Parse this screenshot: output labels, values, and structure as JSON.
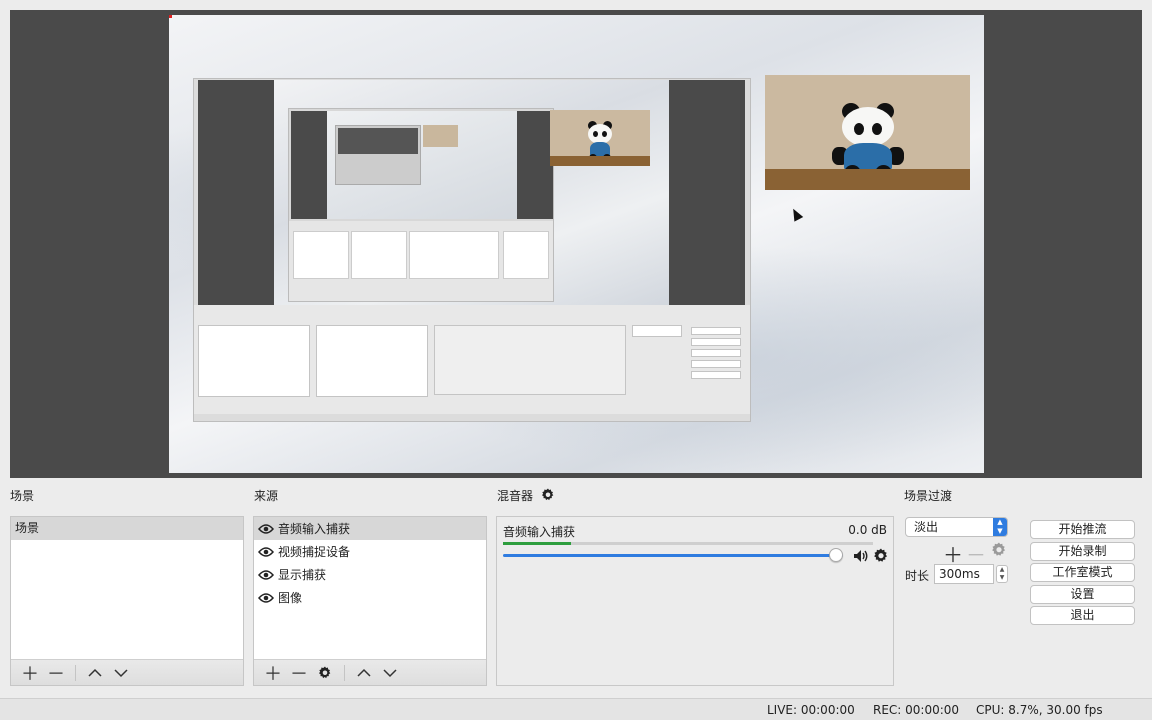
{
  "panels": {
    "scenes_title": "场景",
    "sources_title": "来源",
    "mixer_title": "混音器",
    "transitions_title": "场景过渡"
  },
  "scenes": {
    "items": [
      {
        "label": "场景"
      }
    ]
  },
  "sources": {
    "items": [
      {
        "label": "音频输入捕获",
        "icon": "eye-icon"
      },
      {
        "label": "视频捕捉设备",
        "icon": "eye-icon"
      },
      {
        "label": "显示捕获",
        "icon": "eye-icon"
      },
      {
        "label": "图像",
        "icon": "eye-icon"
      }
    ]
  },
  "mixer": {
    "track_name": "音频输入捕获",
    "level": "0.0 dB",
    "volume_fraction": 0.98
  },
  "transitions": {
    "selected": "淡出",
    "duration_label": "时长",
    "duration_value": "300ms"
  },
  "controls": {
    "start_streaming": "开始推流",
    "start_recording": "开始录制",
    "studio_mode": "工作室模式",
    "settings": "设置",
    "exit": "退出"
  },
  "status": {
    "live": "LIVE: 00:00:00",
    "rec": "REC: 00:00:00",
    "cpu": "CPU: 8.7%, 30.00 fps"
  },
  "colors": {
    "preview_bg": "#4a4a4a",
    "accent": "#2f7ce0",
    "meter_green": "#2e9e3e"
  }
}
